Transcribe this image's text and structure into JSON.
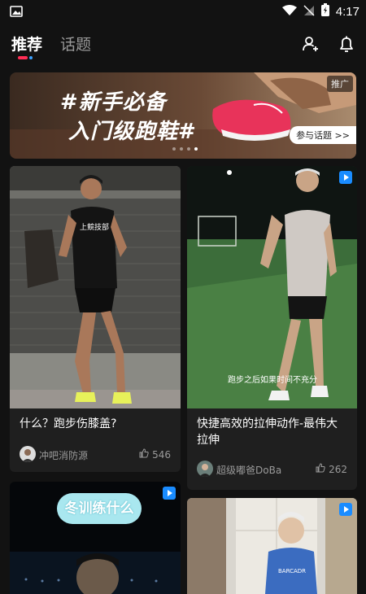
{
  "status_bar": {
    "time": "4:17"
  },
  "nav": {
    "tabs": [
      {
        "label": "推荐",
        "active": true
      },
      {
        "label": "话题",
        "active": false
      }
    ]
  },
  "banner": {
    "line1": "#新手必备",
    "line2": "入门级跑鞋#",
    "badge": "推广",
    "cta": "参与话题 >>"
  },
  "feed": [
    {
      "title": "什么？跑步伤膝盖?",
      "author": "冲吧消防源",
      "likes": "546",
      "shirt": "上競技部"
    },
    {
      "title": "快捷高效的拉伸动作-最伟大拉伸",
      "author": "超级嘟爸DoBa",
      "likes": "262",
      "subtitle": "跑步之后如果时间不充分"
    },
    {
      "bubble": "冬训练什么"
    },
    {
      "shirt": "BARCADR"
    }
  ],
  "colors": {
    "accent": "#ff2d55",
    "video_badge": "#1a8cff",
    "background": "#121212",
    "card": "#1f1f1f"
  }
}
